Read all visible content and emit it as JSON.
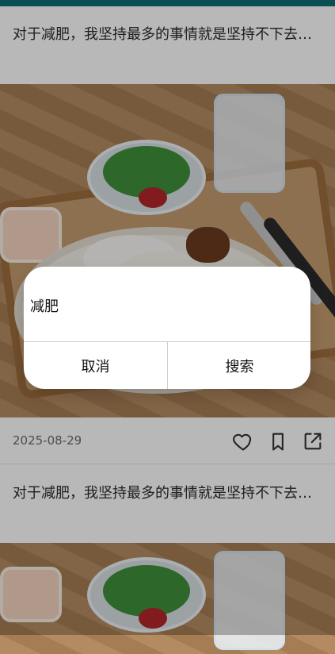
{
  "feed": {
    "cards": [
      {
        "title": "对于减肥，我坚持最多的事情就是坚持不下去…",
        "date": "2025-08-29",
        "icons": [
          "heart-icon",
          "bookmark-icon",
          "share-icon"
        ]
      },
      {
        "title": "对于减肥，我坚持最多的事情就是坚持不下去…"
      }
    ]
  },
  "dialog": {
    "text": "减肥",
    "cancel_label": "取消",
    "search_label": "搜索"
  }
}
